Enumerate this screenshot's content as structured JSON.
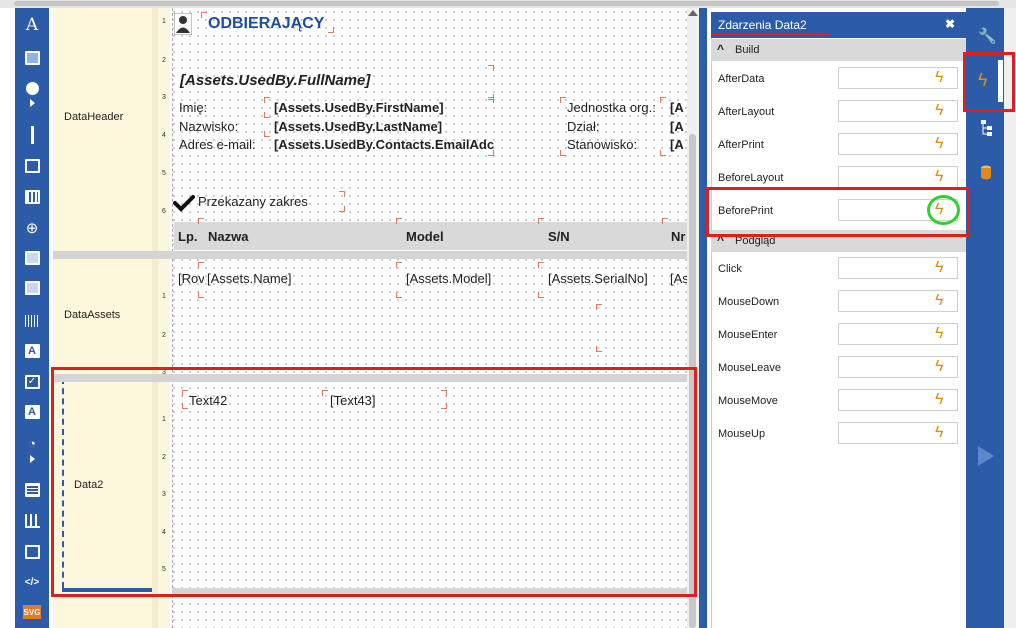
{
  "report": {
    "title": "ODBIERAJĄCY",
    "full_name": "[Assets.UsedBy.FullName]",
    "labels": {
      "first_name": "Imię:",
      "last_name": "Nazwisko:",
      "email": "Adres e-mail:",
      "org_unit": "Jednostka org.:",
      "department": "Dział:",
      "position": "Stanowisko:"
    },
    "fields": {
      "first_name": "[Assets.UsedBy.FirstName]",
      "last_name": "[Assets.UsedBy.LastName]",
      "email": "[Assets.UsedBy.Contacts.EmailAdc",
      "org_unit": "[A",
      "department": "[A",
      "position": "[A"
    },
    "scope_label": "Przekazany zakres",
    "table_headers": [
      "Lp.",
      "Nazwa",
      "Model",
      "S/N",
      "Nr"
    ],
    "table_row": [
      "[Rov",
      "[Assets.Name]",
      "[Assets.Model]",
      "[Assets.SerialNo]",
      "[As"
    ],
    "data2_text1": "Text42",
    "data2_text2": "[Text43]"
  },
  "bands": [
    "DataHeader",
    "DataAssets",
    "Data2"
  ],
  "ruler_numbers": {
    "header": [
      "1",
      "2",
      "3",
      "4",
      "5",
      "6"
    ],
    "assets": [
      "1",
      "2",
      "3"
    ],
    "data2": [
      "1",
      "2",
      "3",
      "4",
      "5"
    ]
  },
  "events_panel": {
    "title": "Zdarzenia Data2",
    "close_glyph": "✖",
    "categories": [
      "Build",
      "Podgląd"
    ],
    "build_events": [
      "AfterData",
      "AfterLayout",
      "AfterPrint",
      "BeforeLayout",
      "BeforePrint"
    ],
    "preview_events": [
      "Click",
      "MouseDown",
      "MouseEnter",
      "MouseLeave",
      "MouseMove",
      "MouseUp"
    ]
  },
  "colors": {
    "toolbar": "#2c5ba7",
    "highlight_red": "#dd1f1f",
    "highlight_green": "#2ed22e",
    "bolt": "#e08a17",
    "title_blue": "#1f4e9a"
  },
  "icons": {
    "left_toolbar": [
      "text-icon",
      "image-icon",
      "shape-icon",
      "line-icon",
      "panel-icon",
      "table-icon",
      "globe-icon",
      "subreport-icon",
      "crosstab-icon",
      "barcode-icon",
      "richtext-icon",
      "checkbox-icon",
      "textbox-icon",
      "gauge-icon",
      "grid-icon",
      "chart-icon",
      "map-icon",
      "code-icon",
      "svg-icon"
    ],
    "left_toolbar_svg_label": "SVG",
    "right_toolbar": [
      "wrench-icon",
      "events-bolt-icon",
      "tree-icon",
      "database-icon",
      "play-icon"
    ]
  }
}
